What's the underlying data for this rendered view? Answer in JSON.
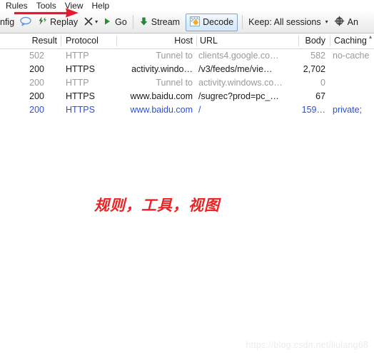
{
  "menubar": {
    "items": [
      {
        "label": "Rules",
        "name": "menu-rules"
      },
      {
        "label": "Tools",
        "name": "menu-tools"
      },
      {
        "label": "View",
        "name": "menu-view"
      },
      {
        "label": "Help",
        "name": "menu-help"
      }
    ]
  },
  "toolbar": {
    "config_label": "nfig",
    "comment_icon": "speech-bubble-icon",
    "replay_icon": "replay-lightning-icon",
    "replay_label": "Replay",
    "remove_icon": "x-icon",
    "remove_caret": "▾",
    "go_icon": "play-triangle-icon",
    "go_label": "Go",
    "stream_icon": "green-down-arrow-icon",
    "stream_label": "Stream",
    "decode_icon": "checkered-decode-icon",
    "decode_label": "Decode",
    "keep_label": "Keep: All sessions",
    "keep_caret": "▾",
    "any_icon": "globe-crosshair-icon",
    "any_label": "An"
  },
  "grid": {
    "columns": [
      {
        "label": "Result",
        "name": "col-result"
      },
      {
        "label": "Protocol",
        "name": "col-protocol"
      },
      {
        "label": "Host",
        "name": "col-host"
      },
      {
        "label": "URL",
        "name": "col-url"
      },
      {
        "label": "Body",
        "name": "col-body"
      },
      {
        "label": "Caching",
        "name": "col-caching"
      }
    ],
    "sort_indicator": "▴",
    "rows": [
      {
        "style": "grey",
        "result": "502",
        "protocol": "HTTP",
        "host": "Tunnel to",
        "url": "clients4.google.co…",
        "body": "582",
        "caching": "no-cache"
      },
      {
        "style": "dark",
        "result": "200",
        "protocol": "HTTPS",
        "host": "activity.windo…",
        "url": "/v3/feeds/me/vie…",
        "body": "2,702",
        "caching": ""
      },
      {
        "style": "grey",
        "result": "200",
        "protocol": "HTTP",
        "host": "Tunnel to",
        "url": "activity.windows.co…",
        "body": "0",
        "caching": ""
      },
      {
        "style": "dark",
        "result": "200",
        "protocol": "HTTPS",
        "host": "www.baidu.com",
        "url": "/sugrec?prod=pc_…",
        "body": "67",
        "caching": ""
      },
      {
        "style": "blue",
        "result": "200",
        "protocol": "HTTPS",
        "host": "www.baidu.com",
        "url": "/",
        "body": "159…",
        "caching": "private; "
      }
    ]
  },
  "annotation": {
    "text": "规则，工具，视图",
    "color": "#ee2222"
  },
  "watermark": {
    "text": "https://blog.csdn.net/liulang68"
  }
}
